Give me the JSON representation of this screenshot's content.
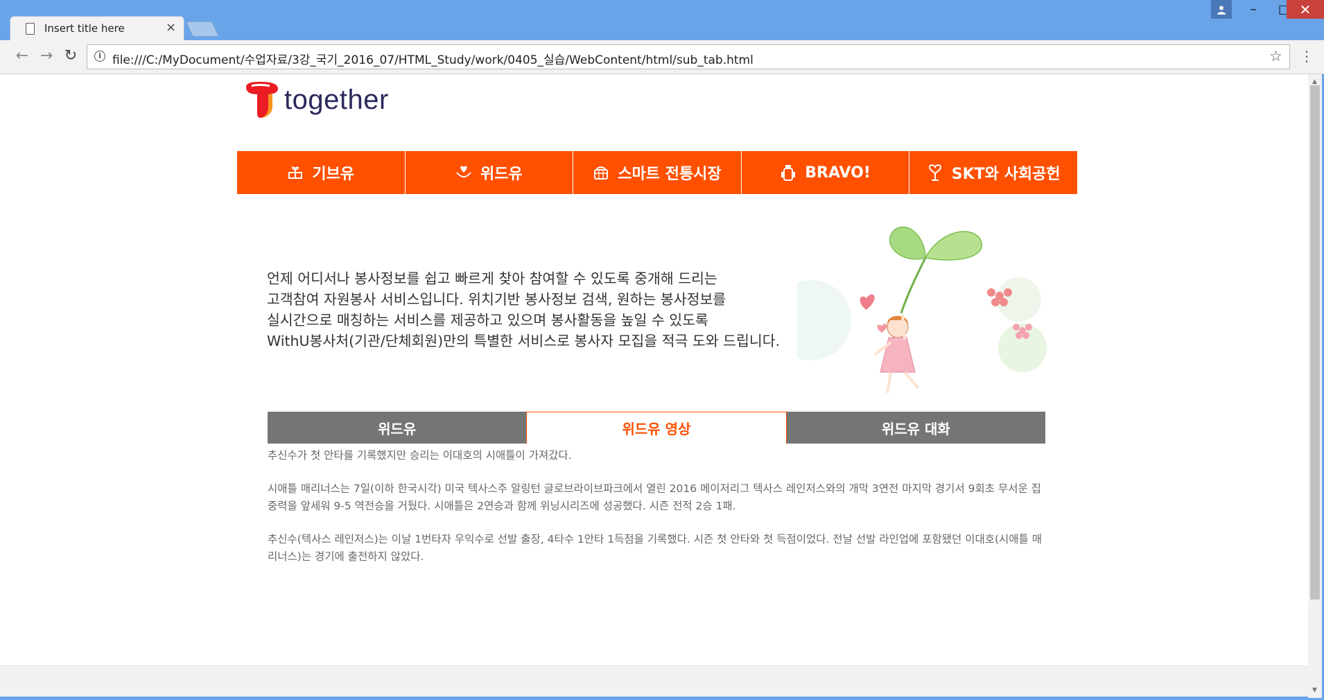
{
  "browser": {
    "tab_title": "Insert title here",
    "tab_close": "×",
    "url": "file:///C:/MyDocument/수업자료/3강_국기_2016_07/HTML_Study/work/0405_실습/WebContent/html/sub_tab.html",
    "back_icon": "←",
    "forward_icon": "→",
    "reload_icon": "↻",
    "star_icon": "☆",
    "menu_icon": "⋮",
    "min_icon": "–",
    "max_icon": "□",
    "close_icon": "✕",
    "user_icon": "👤"
  },
  "logo": {
    "text": "together"
  },
  "gnb": {
    "items": [
      {
        "label": "기브유",
        "icon": "gift-icon"
      },
      {
        "label": "위드유",
        "icon": "hands-heart-icon"
      },
      {
        "label": "스마트 전통시장",
        "icon": "basket-icon"
      },
      {
        "label": "BRAVO!",
        "icon": "bottle-icon"
      },
      {
        "label": "SKT와 사회공헌",
        "icon": "heart-tree-icon"
      }
    ]
  },
  "intro": {
    "lines": [
      "언제 어디서나 봉사정보를 쉽고 빠르게 찾아 참여할 수 있도록 중개해 드리는",
      "고객참여 자원봉사 서비스입니다. 위치기반 봉사정보 검색, 원하는 봉사정보를",
      "실시간으로 매칭하는 서비스를 제공하고 있으며 봉사활동을 높일 수 있도록",
      "WithU봉사처(기관/단체회원)만의 특별한 서비스로 봉사자 모집을 적극 도와 드립니다."
    ]
  },
  "tabs": {
    "items": [
      "위드유",
      "위드유 영상",
      "위드유 대화"
    ],
    "active_index": 1
  },
  "article": {
    "paragraphs": [
      "추신수가 첫 안타를 기록했지만 승리는 이대호의 시애틀이 가져갔다.",
      "시애틀 매리너스는 7일(이하 한국시각) 미국 텍사스주 알링턴 글로브라이브파크에서 열린 2016 메이저리그 텍사스 레인저스와의 개막 3연전 마지막 경기서 9회초 무서운 집중력을 앞세워 9-5 역전승을 거뒀다. 시애틀은 2연승과 함께 위닝시리즈에 성공했다. 시즌 전적 2승 1패.",
      "추신수(텍사스 레인저스)는 이날 1번타자 우익수로 선발 출장, 4타수 1안타 1득점을 기록했다. 시즌 첫 안타와 첫 득점이었다. 전날 선발 라인업에 포함됐던 이대호(시애틀 매리너스)는 경기에 출전하지 않았다."
    ]
  },
  "colors": {
    "accent": "#ff5000",
    "tab_inactive": "#757575",
    "window_frame": "#6aa4e8"
  }
}
